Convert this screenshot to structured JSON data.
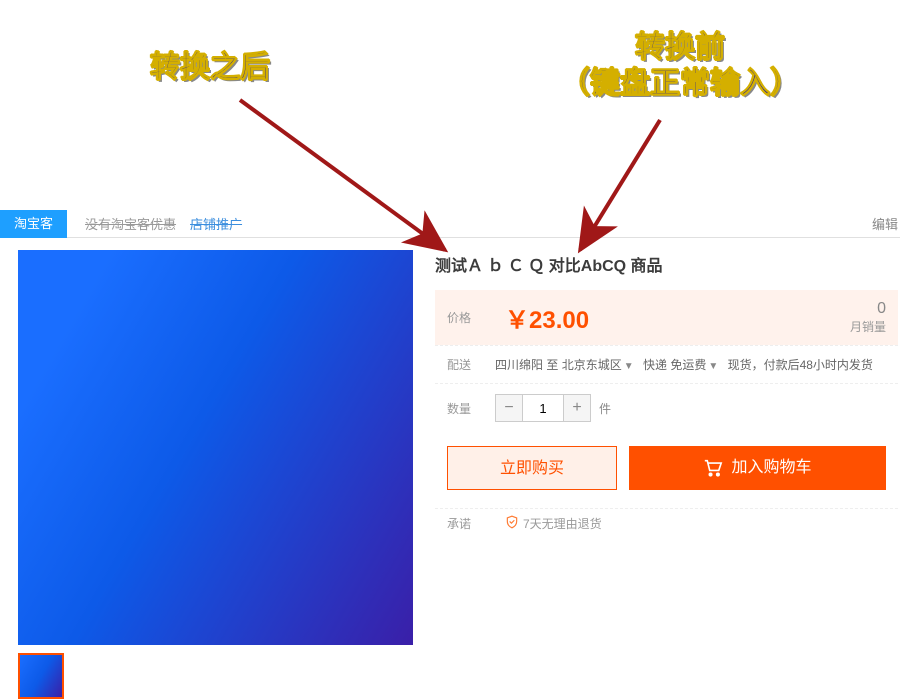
{
  "annotations": {
    "left": "转换之后",
    "right_line1": "转换前",
    "right_line2": "（键盘正常输入）"
  },
  "topbar": {
    "active_tab": "淘宝客",
    "no_discount_text": "没有淘宝客优惠",
    "shop_rec_link": "店铺推广",
    "edit_link": "编辑"
  },
  "product": {
    "title": "测试Ａ ｂ Ｃ Ｑ  对比AbCQ 商品"
  },
  "price_band": {
    "label": "价格",
    "price": "￥23.00",
    "sales_count": "0",
    "sales_label": "月销量"
  },
  "shipping": {
    "label": "配送",
    "from": "四川绵阳",
    "to_word": "至",
    "to": "北京东城区",
    "express": "快递 免运费",
    "stock": "现货，付款后48小时内发货"
  },
  "quantity": {
    "label": "数量",
    "value": "1",
    "unit": "件"
  },
  "buttons": {
    "buy_now": "立即购买",
    "add_cart": "加入购物车"
  },
  "promise": {
    "label": "承诺",
    "text": "7天无理由退货"
  }
}
